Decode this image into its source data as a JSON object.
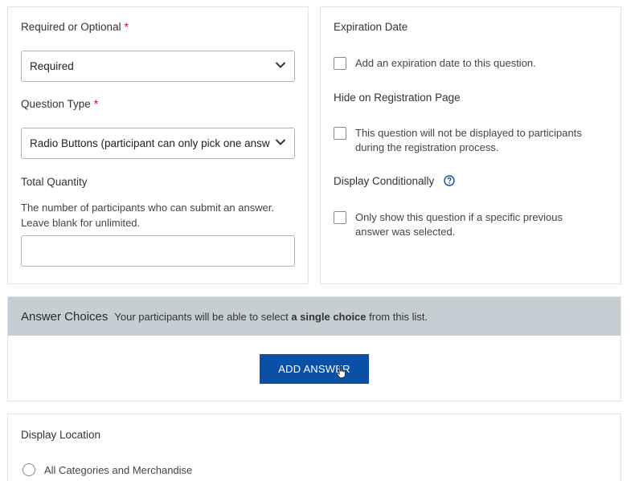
{
  "required": {
    "label": "Required or Optional",
    "asterisk": "*",
    "selected": "Required"
  },
  "question_type": {
    "label": "Question Type",
    "asterisk": "*",
    "selected": "Radio Buttons (participant can only pick one answer)"
  },
  "total_quantity": {
    "label": "Total Quantity",
    "help": "The number of participants who can submit an answer. Leave blank for unlimited.",
    "value": ""
  },
  "expiration": {
    "label": "Expiration Date",
    "checkbox_text": "Add an expiration date to this question.",
    "checked": false
  },
  "hide_registration": {
    "label": "Hide on Registration Page",
    "checkbox_text": "This question will not be displayed to participants during the registration process.",
    "checked": false
  },
  "display_conditionally": {
    "label": "Display Conditionally",
    "icon": "help-circle-icon",
    "checkbox_text": "Only show this question if a specific previous answer was selected.",
    "checked": false
  },
  "answer_choices": {
    "title": "Answer Choices",
    "desc_prefix": "Your participants will be able to select ",
    "desc_bold": "a single choice",
    "desc_suffix": " from this list.",
    "add_button": "ADD ANSWER"
  },
  "display_location": {
    "label": "Display Location",
    "options": [
      {
        "label": "All Categories and Merchandise",
        "selected": false
      }
    ]
  },
  "colors": {
    "accent": "#0b4fa7",
    "required_star": "#d0021b",
    "header_bg": "#c5ced3"
  }
}
